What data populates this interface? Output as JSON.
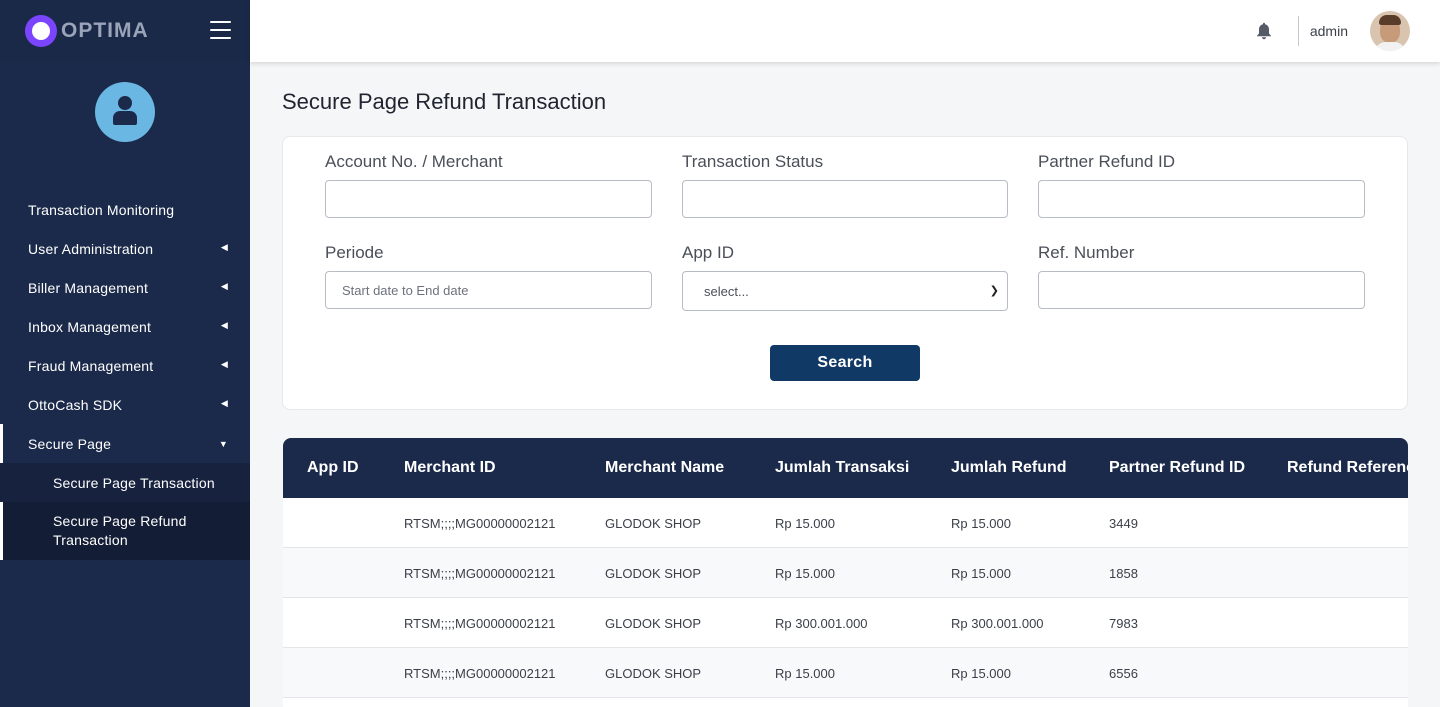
{
  "brand": {
    "name": "OPTIMA"
  },
  "topbar": {
    "username": "admin"
  },
  "sidebar": {
    "items": [
      {
        "label": "Transaction Monitoring",
        "has_children": false
      },
      {
        "label": "User Administration",
        "has_children": true
      },
      {
        "label": "Biller Management",
        "has_children": true
      },
      {
        "label": "Inbox Management",
        "has_children": true
      },
      {
        "label": "Fraud Management",
        "has_children": true
      },
      {
        "label": "OttoCash SDK",
        "has_children": true
      },
      {
        "label": "Secure Page",
        "has_children": true,
        "expanded": true
      }
    ],
    "subitems": [
      {
        "label": "Secure Page Transaction"
      },
      {
        "label": "Secure Page Refund Transaction",
        "active": true
      }
    ]
  },
  "page": {
    "title": "Secure Page Refund Transaction"
  },
  "filters": {
    "account_label": "Account No. / Merchant",
    "account_value": "",
    "status_label": "Transaction Status",
    "status_value": "",
    "partner_refund_label": "Partner Refund ID",
    "partner_refund_value": "",
    "periode_label": "Periode",
    "periode_placeholder": "Start date to End date",
    "appid_label": "App ID",
    "appid_selected": "select...",
    "refnum_label": "Ref. Number",
    "refnum_value": "",
    "search_label": "Search"
  },
  "table": {
    "columns": [
      "App ID",
      "Merchant ID",
      "Merchant Name",
      "Jumlah Transaksi",
      "Jumlah Refund",
      "Partner Refund ID",
      "Refund Reference"
    ],
    "rows": [
      {
        "app_id": "",
        "merchant_id": "RTSM;;;;MG00000002121",
        "merchant_name": "GLODOK SHOP",
        "jumlah_transaksi": "Rp 15.000",
        "jumlah_refund": "Rp 15.000",
        "partner_refund_id": "3449",
        "refund_reference": ""
      },
      {
        "app_id": "",
        "merchant_id": "RTSM;;;;MG00000002121",
        "merchant_name": "GLODOK SHOP",
        "jumlah_transaksi": "Rp 15.000",
        "jumlah_refund": "Rp 15.000",
        "partner_refund_id": "1858",
        "refund_reference": ""
      },
      {
        "app_id": "",
        "merchant_id": "RTSM;;;;MG00000002121",
        "merchant_name": "GLODOK SHOP",
        "jumlah_transaksi": "Rp 300.001.000",
        "jumlah_refund": "Rp 300.001.000",
        "partner_refund_id": "7983",
        "refund_reference": ""
      },
      {
        "app_id": "",
        "merchant_id": "RTSM;;;;MG00000002121",
        "merchant_name": "GLODOK SHOP",
        "jumlah_transaksi": "Rp 15.000",
        "jumlah_refund": "Rp 15.000",
        "partner_refund_id": "6556",
        "refund_reference": ""
      }
    ]
  },
  "colors": {
    "sidebar_bg": "#1b2a4a",
    "table_header_bg": "#1b2a4a",
    "button_bg": "#113965",
    "logo_accent": "#7b45ff",
    "avatar_bg": "#6ab7e3"
  }
}
